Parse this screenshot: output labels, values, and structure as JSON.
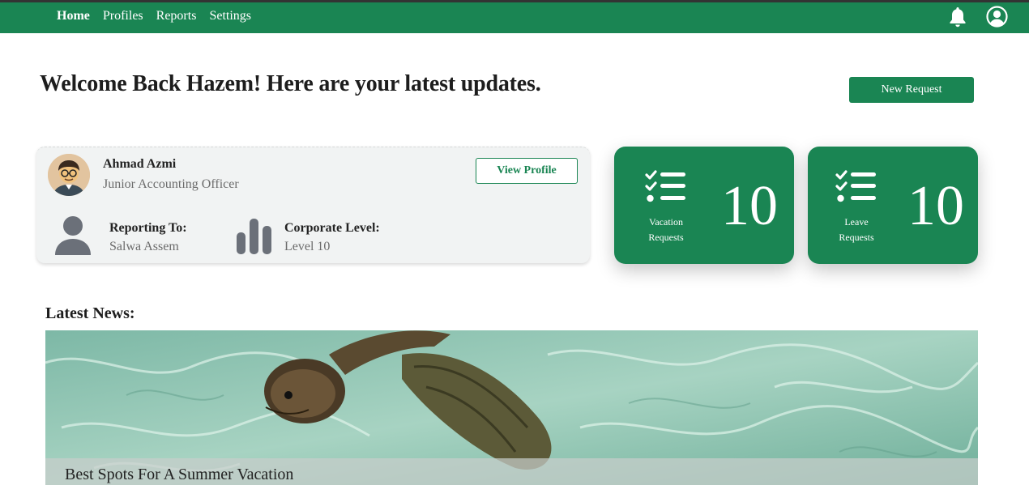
{
  "nav": {
    "items": [
      {
        "label": "Home",
        "active": true
      },
      {
        "label": "Profiles",
        "active": false
      },
      {
        "label": "Reports",
        "active": false
      },
      {
        "label": "Settings",
        "active": false
      }
    ],
    "icons": [
      "bell-icon",
      "user-account-icon"
    ]
  },
  "welcome": {
    "title": "Welcome Back Hazem! Here are your latest updates.",
    "new_request_label": "New Request"
  },
  "profile": {
    "name": "Ahmad Azmi",
    "job_title": "Junior Accounting Officer",
    "view_profile_label": "View Profile",
    "reporting_to_label": "Reporting To:",
    "reporting_to_value": "Salwa Assem",
    "corporate_level_label": "Corporate Level:",
    "corporate_level_value": "Level 10"
  },
  "stats": {
    "vacation": {
      "label_line1": "Vacation",
      "label_line2": "Requests",
      "count": "10"
    },
    "leave": {
      "label_line1": "Leave",
      "label_line2": "Requests",
      "count": "10"
    }
  },
  "news": {
    "heading": "Latest News:",
    "items": [
      {
        "caption": "Best Spots For A Summer Vacation"
      }
    ]
  },
  "colors": {
    "brand_green": "#1a8553",
    "card_bg": "#f1f3f3",
    "muted_text": "#6b6b6b"
  }
}
